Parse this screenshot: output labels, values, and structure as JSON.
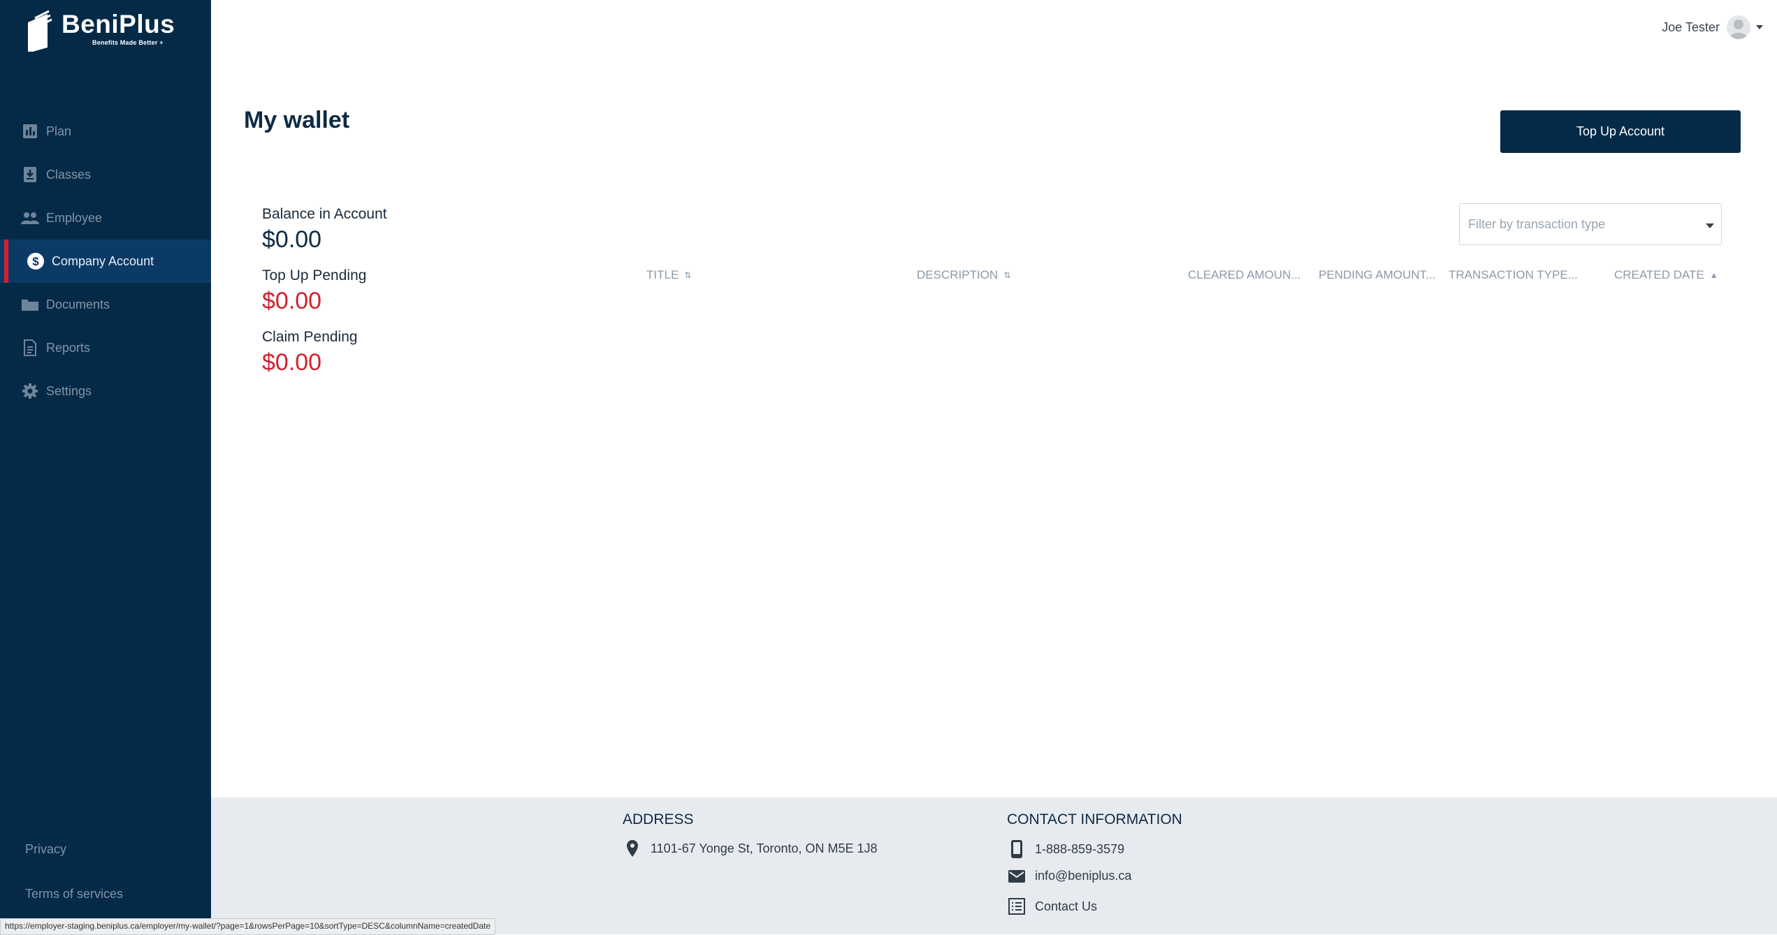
{
  "brand": {
    "name": "BeniPlus",
    "tagline": "Benefits Made Better +"
  },
  "sidebar": {
    "items": [
      {
        "label": "Plan",
        "icon": "bar-chart-icon"
      },
      {
        "label": "Classes",
        "icon": "download-box-icon"
      },
      {
        "label": "Employee",
        "icon": "people-icon"
      },
      {
        "label": "Company Account",
        "icon": "dollar-icon",
        "active": true
      },
      {
        "label": "Documents",
        "icon": "folder-icon"
      },
      {
        "label": "Reports",
        "icon": "document-icon"
      },
      {
        "label": "Settings",
        "icon": "gear-icon"
      }
    ],
    "privacy": "Privacy",
    "terms": "Terms of services"
  },
  "header": {
    "user_name": "Joe Tester"
  },
  "page": {
    "title": "My wallet",
    "topup_label": "Top Up Account",
    "balance_label": "Balance in Account",
    "balance_value": "$0.00",
    "topup_pending_label": "Top Up Pending",
    "topup_pending_value": "$0.00",
    "claim_pending_label": "Claim Pending",
    "claim_pending_value": "$0.00",
    "filter_placeholder": "Filter by transaction type"
  },
  "table": {
    "columns": [
      "TITLE",
      "DESCRIPTION",
      "CLEARED AMOUN...",
      "PENDING AMOUNT...",
      "TRANSACTION TYPE...",
      "CREATED DATE"
    ],
    "rows": []
  },
  "footer": {
    "address_title": "ADDRESS",
    "address": "1101-67 Yonge St, Toronto, ON M5E 1J8",
    "contact_title": "CONTACT INFORMATION",
    "phone": "1-888-859-3579",
    "email": "info@beniplus.ca",
    "contact_us": "Contact Us"
  },
  "status_url": "https://employer-staging.beniplus.ca/employer/my-wallet/?page=1&rowsPerPage=10&sortType=DESC&columnName=createdDate",
  "colors": {
    "sidebar": "#052a48",
    "active_item": "#0c3a66",
    "accent_red": "#d3202f",
    "footer": "#e7ebef"
  }
}
